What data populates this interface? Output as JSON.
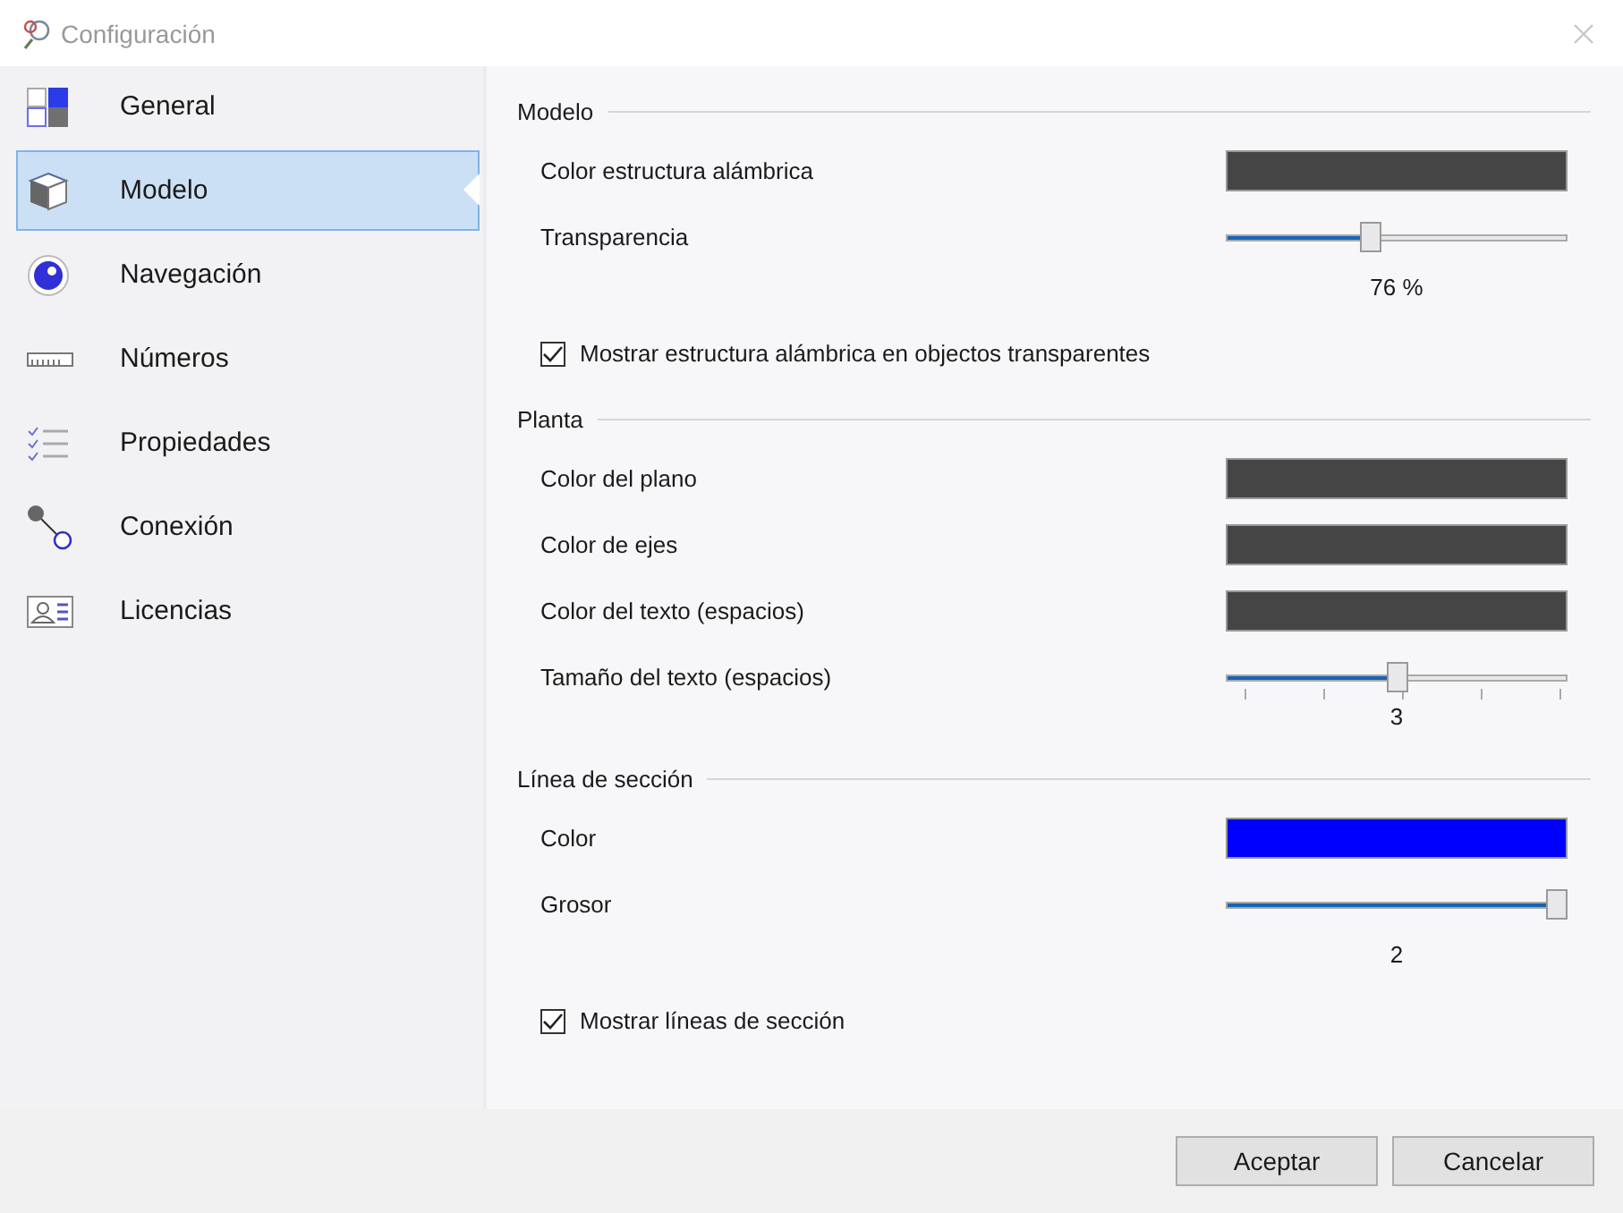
{
  "window": {
    "title": "Configuración"
  },
  "sidebar": {
    "items": [
      {
        "label": "General",
        "selected": false
      },
      {
        "label": "Modelo",
        "selected": true
      },
      {
        "label": "Navegación",
        "selected": false
      },
      {
        "label": "Números",
        "selected": false
      },
      {
        "label": "Propiedades",
        "selected": false
      },
      {
        "label": "Conexión",
        "selected": false
      },
      {
        "label": "Licencias",
        "selected": false
      }
    ]
  },
  "sections": [
    {
      "title": "Modelo",
      "rows": [
        {
          "kind": "color",
          "label": "Color estructura alámbrica",
          "color": "#454545"
        },
        {
          "kind": "slider",
          "label": "Transparencia",
          "level": 0.42,
          "reading": "76 %",
          "ticks": false
        },
        {
          "kind": "checkbox",
          "label": "Mostrar estructura alámbrica en objectos transparentes",
          "checked": true
        }
      ]
    },
    {
      "title": "Planta",
      "rows": [
        {
          "kind": "color",
          "label": "Color del plano",
          "color": "#454545"
        },
        {
          "kind": "color",
          "label": "Color de ejes",
          "color": "#454545"
        },
        {
          "kind": "color",
          "label": "Color del texto (espacios)",
          "color": "#454545"
        },
        {
          "kind": "slider",
          "label": "Tamaño del texto (espacios)",
          "level": 0.5,
          "reading": "3",
          "ticks": true
        }
      ]
    },
    {
      "title": "Línea de sección",
      "rows": [
        {
          "kind": "color",
          "label": "Color",
          "color": "#0000ff"
        },
        {
          "kind": "slider",
          "label": "Grosor",
          "level": 1,
          "reading": "2",
          "ticks": false
        },
        {
          "kind": "checkbox",
          "label": "Mostrar líneas de sección",
          "checked": true
        }
      ]
    }
  ],
  "buttons": [
    "Aceptar",
    "Cancelar"
  ]
}
